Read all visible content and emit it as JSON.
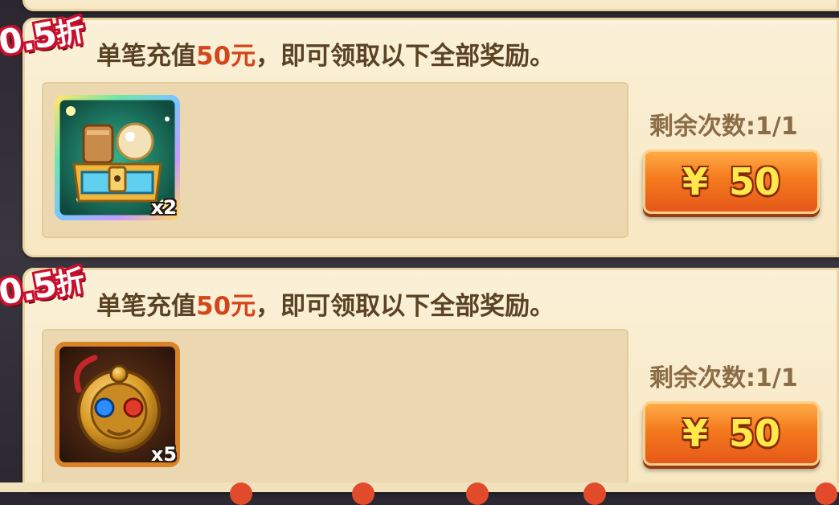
{
  "offers": [
    {
      "discount_value": "0.5",
      "discount_unit": "折",
      "desc_prefix": "单笔充值",
      "desc_amount": "50元",
      "desc_suffix": "，即可领取以下全部奖励。",
      "item_icon": "treasure-chest-icon",
      "item_qty": "x2",
      "remaining": "剩余次数:1/1",
      "price_symbol": "¥",
      "price": "50"
    },
    {
      "discount_value": "0.5",
      "discount_unit": "折",
      "desc_prefix": "单笔充值",
      "desc_amount": "50元",
      "desc_suffix": "，即可领取以下全部奖励。",
      "item_icon": "gold-amulet-icon",
      "item_qty": "x5",
      "remaining": "剩余次数:1/1",
      "price_symbol": "¥",
      "price": "50"
    }
  ],
  "colors": {
    "accent_red": "#c8102e",
    "amount_orange": "#d2461b",
    "button_orange": "#f47a1d",
    "price_yellow": "#ffe94a"
  }
}
